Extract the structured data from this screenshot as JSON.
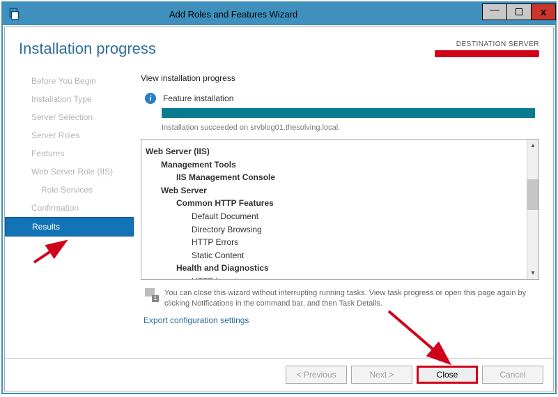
{
  "window": {
    "title": "Add Roles and Features Wizard"
  },
  "heading": "Installation progress",
  "destination": {
    "label": "DESTINATION SERVER",
    "server": "(redacted)"
  },
  "sidebar": {
    "items": [
      {
        "label": "Before You Begin"
      },
      {
        "label": "Installation Type"
      },
      {
        "label": "Server Selection"
      },
      {
        "label": "Server Roles"
      },
      {
        "label": "Features"
      },
      {
        "label": "Web Server Role (IIS)"
      },
      {
        "label": "Role Services",
        "sub": true
      },
      {
        "label": "Confirmation"
      },
      {
        "label": "Results",
        "active": true
      }
    ]
  },
  "main": {
    "view_title": "View installation progress",
    "feature_label": "Feature installation",
    "status": "Installation succeeded on srvblog01.thesolving.local.",
    "tree": [
      {
        "level": 0,
        "text": "Web Server (IIS)"
      },
      {
        "level": 1,
        "text": "Management Tools"
      },
      {
        "level": 2,
        "text": "IIS Management Console"
      },
      {
        "level": 1,
        "text": "Web Server"
      },
      {
        "level": 2,
        "text": "Common HTTP Features"
      },
      {
        "level": 3,
        "text": "Default Document"
      },
      {
        "level": 3,
        "text": "Directory Browsing"
      },
      {
        "level": 3,
        "text": "HTTP Errors"
      },
      {
        "level": 3,
        "text": "Static Content"
      },
      {
        "level": 2,
        "text": "Health and Diagnostics"
      },
      {
        "level": 3,
        "text": "HTTP Logging"
      }
    ],
    "note": "You can close this wizard without interrupting running tasks. View task progress or open this page again by clicking Notifications in the command bar, and then Task Details.",
    "export_link": "Export configuration settings"
  },
  "footer": {
    "previous": "< Previous",
    "next": "Next >",
    "close": "Close",
    "cancel": "Cancel"
  }
}
